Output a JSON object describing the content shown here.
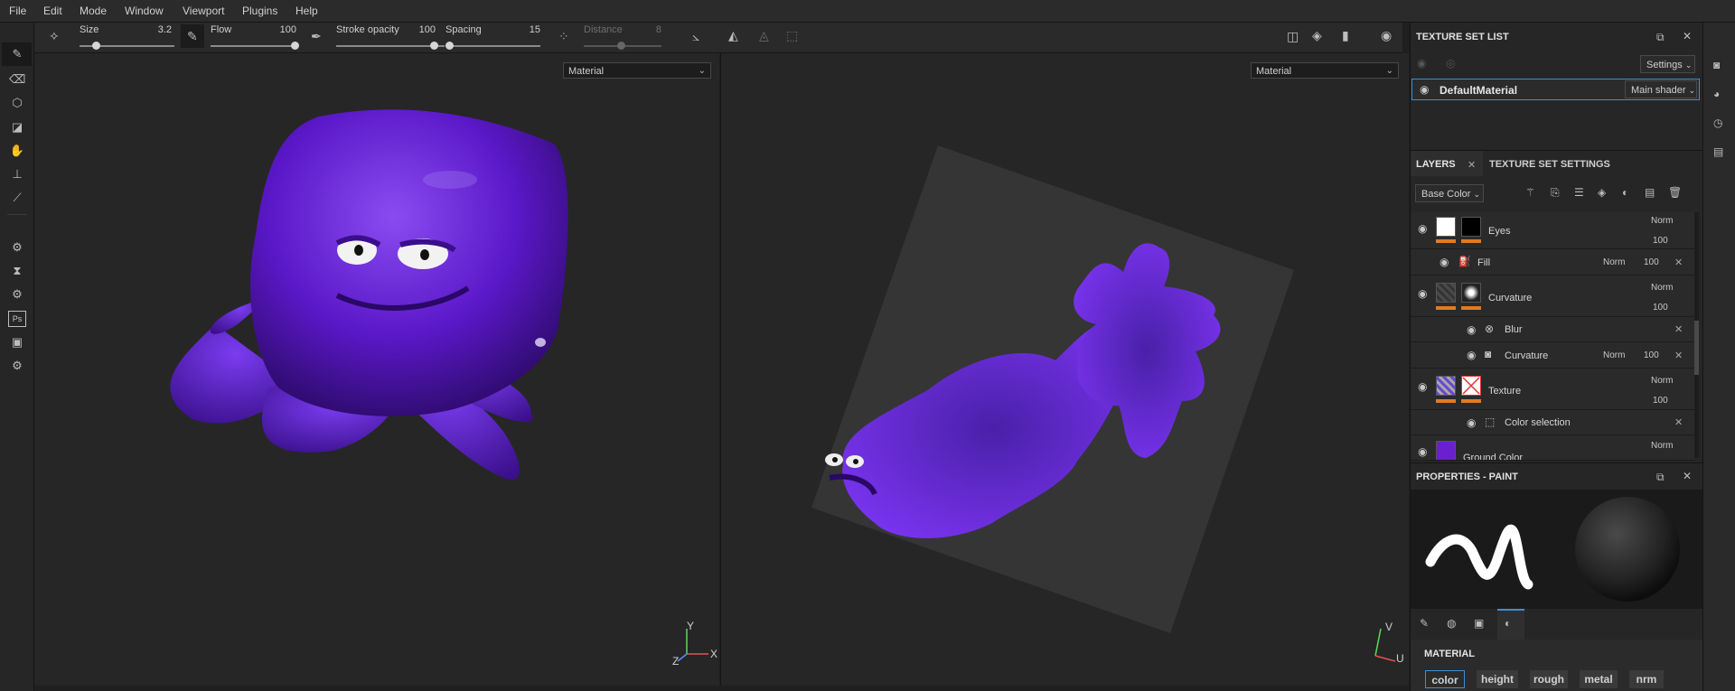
{
  "menu": {
    "items": [
      "File",
      "Edit",
      "Mode",
      "Window",
      "Viewport",
      "Plugins",
      "Help"
    ]
  },
  "toolbar": {
    "size_label": "Size",
    "size_value": "3.2",
    "flow_label": "Flow",
    "flow_value": "100",
    "stroke_opacity_label": "Stroke opacity",
    "stroke_opacity_value": "100",
    "spacing_label": "Spacing",
    "spacing_value": "15",
    "distance_label": "Distance",
    "distance_value": "8"
  },
  "viewports": {
    "left_select": "Material",
    "right_select": "Material",
    "left_axes": {
      "y": "Y",
      "x": "X",
      "z": "Z"
    },
    "right_axes": {
      "v": "V",
      "u": "U"
    }
  },
  "texture_set_list": {
    "title": "TEXTURE SET LIST",
    "settings_label": "Settings",
    "material_name": "DefaultMaterial",
    "shader_label": "Main shader"
  },
  "layers_panel": {
    "tab_layers": "LAYERS",
    "tab_tss": "TEXTURE SET SETTINGS",
    "channel": "Base Color",
    "layers": [
      {
        "name": "Eyes",
        "blend": "Norm",
        "opacity": "100"
      },
      {
        "name": "Fill",
        "blend": "Norm",
        "opacity": "100"
      },
      {
        "name": "Curvature",
        "blend": "Norm",
        "opacity": "100"
      },
      {
        "name": "Blur"
      },
      {
        "name": "Curvature",
        "blend": "Norm",
        "opacity": "100"
      },
      {
        "name": "Texture",
        "blend": "Norm",
        "opacity": "100"
      },
      {
        "name": "Color selection"
      },
      {
        "name": "Ground Color",
        "blend": "Norm"
      }
    ]
  },
  "properties": {
    "title": "PROPERTIES - PAINT",
    "material_heading": "MATERIAL",
    "channels": [
      "color",
      "height",
      "rough",
      "metal",
      "nrm"
    ]
  },
  "colors": {
    "accent": "#3d8fd6",
    "orange": "#e07b22",
    "purple": "#6a1fd0"
  },
  "icons": [
    "brush-icon",
    "eraser-icon",
    "projection-icon",
    "polygon-fill-icon",
    "smudge-icon",
    "clone-icon",
    "color-picker-icon",
    "gear-icon",
    "camera-icon",
    "eye-icon",
    "trash-icon"
  ]
}
